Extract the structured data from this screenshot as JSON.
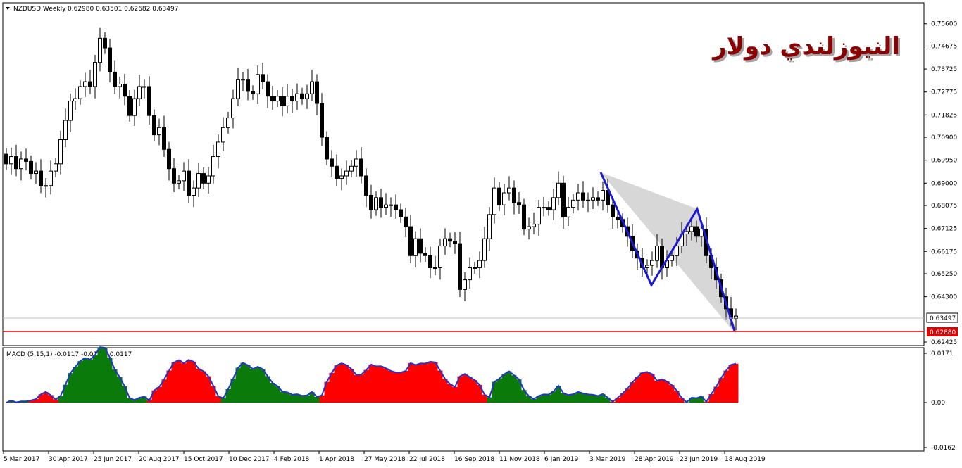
{
  "colors": {
    "bull": "#ffffff",
    "bear": "#000000",
    "wick": "#000000",
    "pattern_line": "#1a1ad4",
    "pattern_fill": "#d3d3d3",
    "support_line": "#e00000",
    "support_label_bg": "#e00000",
    "macd_positive": "#0a7a0a",
    "macd_negative": "#ff0000",
    "macd_line": "#2233cc",
    "watermark_text": "#8b0000"
  },
  "header": {
    "arrow_icon": "triangle-down-icon",
    "symbol": "NZDUSD,Weekly",
    "ohlc": "0.62980 0.63501 0.62682 0.63497"
  },
  "watermark": {
    "text": "النيوزلندي دولار"
  },
  "price_axis": {
    "ticks": [
      "0.75600",
      "0.74675",
      "0.73725",
      "0.72775",
      "0.71825",
      "0.70900",
      "0.69950",
      "0.69000",
      "0.68075",
      "0.67125",
      "0.66175",
      "0.65250",
      "0.64300",
      "0.62425"
    ],
    "current_price_label": "0.63497",
    "support_label": "0.62880"
  },
  "macd_panel": {
    "header": "MACD (5,15,1) -0.0117 -0.0117 -0.0117",
    "ticks": [
      "0.0171",
      "0.00",
      "-0.0162"
    ]
  },
  "time_axis": {
    "labels": [
      "5 Mar 2017",
      "30 Apr 2017",
      "25 Jun 2017",
      "20 Aug 2017",
      "15 Oct 2017",
      "10 Dec 2017",
      "4 Feb 2018",
      "1 Apr 2018",
      "27 May 2018",
      "22 Jul 2018",
      "16 Sep 2018",
      "11 Nov 2018",
      "6 Jan 2019",
      "3 Mar 2019",
      "28 Apr 2019",
      "23 Jun 2019",
      "18 Aug 2019"
    ]
  },
  "chart_data": {
    "type": "candlestick",
    "symbol": "NZDUSD",
    "timeframe": "Weekly",
    "price_range": [
      0.6225,
      0.76
    ],
    "last_close": 0.63497,
    "support_level": 0.6288,
    "closes": [
      0.698,
      0.701,
      0.696,
      0.7,
      0.699,
      0.694,
      0.695,
      0.689,
      0.689,
      0.695,
      0.698,
      0.708,
      0.716,
      0.724,
      0.725,
      0.73,
      0.732,
      0.73,
      0.74,
      0.75,
      0.746,
      0.736,
      0.73,
      0.731,
      0.726,
      0.718,
      0.725,
      0.73,
      0.73,
      0.718,
      0.71,
      0.713,
      0.704,
      0.696,
      0.69,
      0.691,
      0.695,
      0.685,
      0.688,
      0.694,
      0.69,
      0.693,
      0.701,
      0.707,
      0.713,
      0.717,
      0.725,
      0.733,
      0.733,
      0.728,
      0.727,
      0.735,
      0.732,
      0.726,
      0.724,
      0.726,
      0.722,
      0.726,
      0.724,
      0.727,
      0.725,
      0.727,
      0.732,
      0.723,
      0.709,
      0.7,
      0.697,
      0.692,
      0.693,
      0.695,
      0.697,
      0.7,
      0.693,
      0.685,
      0.679,
      0.684,
      0.68,
      0.681,
      0.681,
      0.679,
      0.676,
      0.672,
      0.66,
      0.667,
      0.661,
      0.66,
      0.655,
      0.655,
      0.664,
      0.667,
      0.666,
      0.665,
      0.646,
      0.65,
      0.655,
      0.655,
      0.658,
      0.667,
      0.677,
      0.688,
      0.681,
      0.686,
      0.688,
      0.682,
      0.681,
      0.671,
      0.672,
      0.673,
      0.68,
      0.68,
      0.679,
      0.684,
      0.69,
      0.676,
      0.68,
      0.683,
      0.686,
      0.683,
      0.683,
      0.684,
      0.683,
      0.687,
      0.681,
      0.676,
      0.675,
      0.672,
      0.668,
      0.662,
      0.659,
      0.655,
      0.656,
      0.658,
      0.664,
      0.655,
      0.658,
      0.66,
      0.664,
      0.669,
      0.67,
      0.672,
      0.668,
      0.671,
      0.66,
      0.655,
      0.65,
      0.643,
      0.638,
      0.634,
      0.635
    ]
  }
}
